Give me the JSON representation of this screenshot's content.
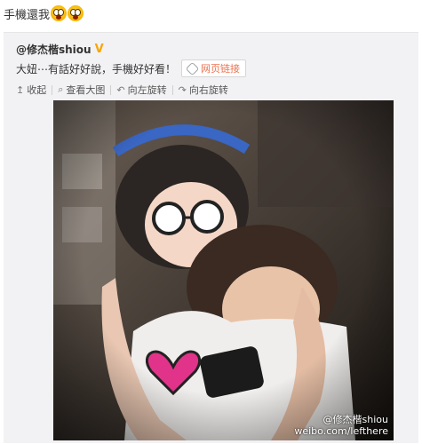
{
  "post": {
    "text": "手機還我"
  },
  "repost": {
    "author": "@修杰楷shiou",
    "text": "大妞⋯有話好好說，手機好好看！",
    "link_label": "网页链接",
    "toolbar": {
      "collect": "收起",
      "view_large": "查看大图",
      "rotate_left": "向左旋转",
      "rotate_right": "向右旋转"
    },
    "photo": {
      "watermark_name": "@修杰楷shiou",
      "watermark_url": "weibo.com/lefthere"
    }
  },
  "colors": {
    "link": "#eb7350",
    "repost_bg": "#f2f2f5",
    "verified": "#f7a600"
  }
}
